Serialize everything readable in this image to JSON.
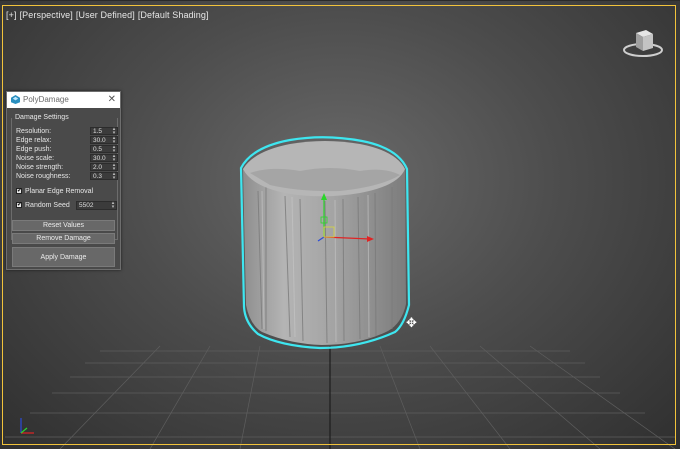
{
  "viewport": {
    "labels": [
      "[+]",
      "[Perspective]",
      "[User Defined]",
      "[Default Shading]"
    ],
    "colors": {
      "active_border": "#f2c33b",
      "selection_outline": "#3ee6f0",
      "object": "#a8a8a8"
    }
  },
  "dialog": {
    "title": "PolyDamage",
    "close_symbol": "✕",
    "group_title": "Damage Settings",
    "params": [
      {
        "label": "Resolution:",
        "value": "1.5"
      },
      {
        "label": "Edge relax:",
        "value": "30.0"
      },
      {
        "label": "Edge push:",
        "value": "0.5"
      },
      {
        "label": "Noise scale:",
        "value": "30.0"
      },
      {
        "label": "Noise strength:",
        "value": "2.0"
      },
      {
        "label": "Noise roughness:",
        "value": "0.3"
      }
    ],
    "planar_edge_removal": {
      "label": "Planar Edge Removal",
      "checked": true
    },
    "random_seed": {
      "label": "Random Seed",
      "checked": true,
      "value": "5502"
    },
    "buttons": {
      "reset": "Reset Values",
      "remove": "Remove Damage",
      "apply": "Apply Damage"
    }
  },
  "icons": {
    "viewcube": "viewcube-icon",
    "move_cursor": "move-cursor-icon",
    "gizmo": "transform-gizmo-icon",
    "axis_tripod": "axis-tripod-icon"
  }
}
